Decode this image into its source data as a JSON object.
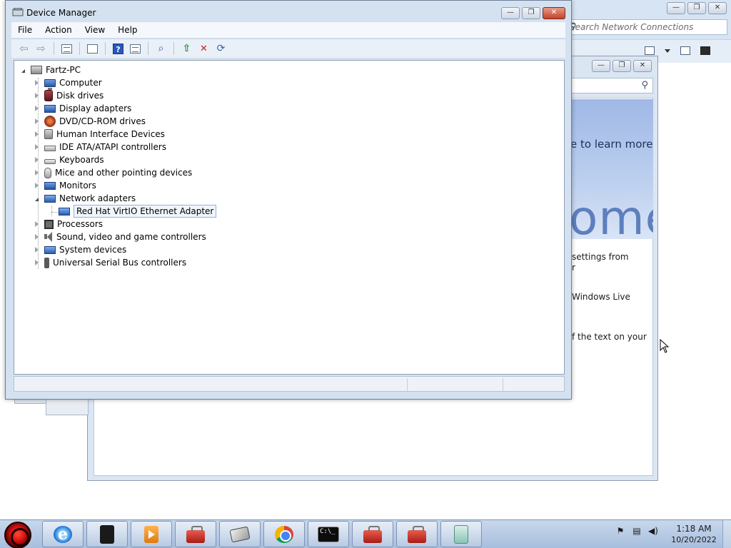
{
  "background": {
    "network_window": {
      "search_placeholder": "Search Network Connections",
      "buttons": {
        "minimize": "—",
        "restore": "❐",
        "close": "✕"
      }
    },
    "live_window": {
      "banner_text": "e to learn more",
      "banner_big": "ome",
      "paragraphs": [
        {
          "line1": "settings from",
          "line2": "r"
        },
        {
          "line1": "Windows Live",
          "line2": ""
        },
        {
          "line1": "f the text on your",
          "line2": ""
        }
      ],
      "buttons": {
        "minimize": "—",
        "restore": "❐",
        "close": "✕"
      }
    }
  },
  "device_manager": {
    "title": "Device Manager",
    "window_buttons": {
      "minimize": "—",
      "restore": "❐",
      "close": "✕"
    },
    "menu": [
      "File",
      "Action",
      "View",
      "Help"
    ],
    "toolbar_icons": [
      "back-arrow",
      "forward-arrow",
      "show-hide-console-tree",
      "properties",
      "help",
      "show-action-pane",
      "update-driver",
      "disable-device",
      "scan-hardware-changes"
    ],
    "tree": {
      "root": "Fartz-PC",
      "categories": [
        {
          "label": "Computer",
          "icon": "computer-icon",
          "expanded": false
        },
        {
          "label": "Disk drives",
          "icon": "disk-drive-icon",
          "expanded": false
        },
        {
          "label": "Display adapters",
          "icon": "display-adapter-icon",
          "expanded": false
        },
        {
          "label": "DVD/CD-ROM drives",
          "icon": "dvd-drive-icon",
          "expanded": false
        },
        {
          "label": "Human Interface Devices",
          "icon": "hid-icon",
          "expanded": false
        },
        {
          "label": "IDE ATA/ATAPI controllers",
          "icon": "ide-controller-icon",
          "expanded": false
        },
        {
          "label": "Keyboards",
          "icon": "keyboard-icon",
          "expanded": false
        },
        {
          "label": "Mice and other pointing devices",
          "icon": "mouse-icon",
          "expanded": false
        },
        {
          "label": "Monitors",
          "icon": "monitor-icon",
          "expanded": false
        },
        {
          "label": "Network adapters",
          "icon": "network-adapter-icon",
          "expanded": true
        },
        {
          "label": "Processors",
          "icon": "processor-icon",
          "expanded": false
        },
        {
          "label": "Sound, video and game controllers",
          "icon": "sound-icon",
          "expanded": false
        },
        {
          "label": "System devices",
          "icon": "system-device-icon",
          "expanded": false
        },
        {
          "label": "Universal Serial Bus controllers",
          "icon": "usb-icon",
          "expanded": false
        }
      ],
      "network_children": [
        "Red Hat VirtIO Ethernet Adapter"
      ]
    }
  },
  "taskbar": {
    "pinned": [
      "internet-explorer-icon",
      "terminal-icon",
      "media-player-icon",
      "toolbox-icon",
      "tablet-icon",
      "chrome-icon",
      "command-prompt-icon",
      "toolbox-icon",
      "toolbox-icon",
      "notes-icon"
    ],
    "cmd_glyph": "C:\\_",
    "tray_icons": [
      "flag-icon",
      "network-icon",
      "volume-icon"
    ],
    "time": "1:18 AM",
    "date": "10/20/2022"
  },
  "colors": {
    "window_frame": "#d4e1f0",
    "close_button": "#c3422b",
    "selection_border": "#8fb2dc",
    "taskbar": "#b5c9e4"
  }
}
